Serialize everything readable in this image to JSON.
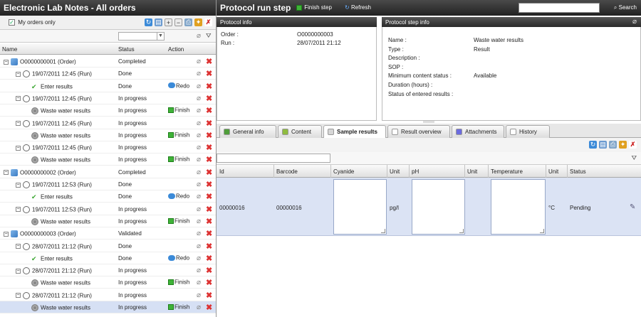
{
  "left": {
    "title": "Electronic Lab Notes - All orders",
    "my_orders_label": "My orders only",
    "columns": {
      "name": "Name",
      "status": "Status",
      "action": "Action"
    },
    "rows": [
      {
        "name": "O0000000001 (Order)",
        "status": "Completed",
        "action": "",
        "icon": "order-icon",
        "level": 0,
        "exp": "⊟"
      },
      {
        "name": "19/07/2011 12:45 (Run)",
        "status": "Done",
        "action": "",
        "icon": "clock-icon",
        "level": 1,
        "exp": "⊟"
      },
      {
        "name": "Enter results",
        "status": "Done",
        "action": "Redo",
        "icon": "check-icon",
        "level": 2,
        "exp": ""
      },
      {
        "name": "19/07/2011 12:45 (Run)",
        "status": "In progress",
        "action": "",
        "icon": "clock-icon",
        "level": 1,
        "exp": "⊟"
      },
      {
        "name": "Waste water results",
        "status": "In progress",
        "action": "Finish",
        "icon": "gear-icon",
        "level": 2,
        "exp": ""
      },
      {
        "name": "19/07/2011 12:45 (Run)",
        "status": "In progress",
        "action": "",
        "icon": "clock-icon",
        "level": 1,
        "exp": "⊟"
      },
      {
        "name": "Waste water results",
        "status": "In progress",
        "action": "Finish",
        "icon": "gear-icon",
        "level": 2,
        "exp": ""
      },
      {
        "name": "19/07/2011 12:45 (Run)",
        "status": "In progress",
        "action": "",
        "icon": "clock-icon",
        "level": 1,
        "exp": "⊟"
      },
      {
        "name": "Waste water results",
        "status": "In progress",
        "action": "Finish",
        "icon": "gear-icon",
        "level": 2,
        "exp": ""
      },
      {
        "name": "O0000000002 (Order)",
        "status": "Completed",
        "action": "",
        "icon": "order-icon",
        "level": 0,
        "exp": "⊟"
      },
      {
        "name": "19/07/2011 12:53 (Run)",
        "status": "Done",
        "action": "",
        "icon": "clock-icon",
        "level": 1,
        "exp": "⊟"
      },
      {
        "name": "Enter results",
        "status": "Done",
        "action": "Redo",
        "icon": "check-icon",
        "level": 2,
        "exp": ""
      },
      {
        "name": "19/07/2011 12:53 (Run)",
        "status": "In progress",
        "action": "",
        "icon": "clock-icon",
        "level": 1,
        "exp": "⊟"
      },
      {
        "name": "Waste water results",
        "status": "In progress",
        "action": "Finish",
        "icon": "gear-icon",
        "level": 2,
        "exp": ""
      },
      {
        "name": "O0000000003 (Order)",
        "status": "Validated",
        "action": "",
        "icon": "order-icon",
        "level": 0,
        "exp": "⊟"
      },
      {
        "name": "28/07/2011 21:12 (Run)",
        "status": "Done",
        "action": "",
        "icon": "clock-icon",
        "level": 1,
        "exp": "⊟"
      },
      {
        "name": "Enter results",
        "status": "Done",
        "action": "Redo",
        "icon": "check-icon",
        "level": 2,
        "exp": ""
      },
      {
        "name": "28/07/2011 21:12 (Run)",
        "status": "In progress",
        "action": "",
        "icon": "clock-icon",
        "level": 1,
        "exp": "⊟"
      },
      {
        "name": "Waste water results",
        "status": "In progress",
        "action": "Finish",
        "icon": "gear-icon",
        "level": 2,
        "exp": ""
      },
      {
        "name": "28/07/2011 21:12 (Run)",
        "status": "In progress",
        "action": "",
        "icon": "clock-icon",
        "level": 1,
        "exp": "⊟"
      },
      {
        "name": "Waste water results",
        "status": "In progress",
        "action": "Finish",
        "icon": "gear-icon",
        "level": 2,
        "exp": "",
        "selected": true
      }
    ]
  },
  "right": {
    "title": "Protocol run step",
    "finish_step_label": "Finish step",
    "refresh_label": "Refresh",
    "search_label": "Search",
    "protocol_info": {
      "header": "Protocol info",
      "order_label": "Order :",
      "order_value": "O0000000003",
      "run_label": "Run :",
      "run_value": "28/07/2011 21:12"
    },
    "step_info": {
      "header": "Protocol step info",
      "fields": [
        {
          "label": "Name :",
          "value": "Waste water results"
        },
        {
          "label": "Type :",
          "value": "Result"
        },
        {
          "label": "Description :",
          "value": ""
        },
        {
          "label": "SOP :",
          "value": ""
        },
        {
          "label": "Minimum content status :",
          "value": "Available"
        },
        {
          "label": "Duration (hours) :",
          "value": ""
        },
        {
          "label": "Status of entered results :",
          "value": ""
        }
      ]
    },
    "tabs": [
      {
        "label": "General info",
        "icon": "pencil-icon"
      },
      {
        "label": "Content",
        "icon": "edit-icon"
      },
      {
        "label": "Sample results",
        "icon": "flask-icon",
        "active": true
      },
      {
        "label": "Result overview",
        "icon": "document-icon"
      },
      {
        "label": "Attachments",
        "icon": "paperclip-icon"
      },
      {
        "label": "History",
        "icon": "history-icon"
      }
    ],
    "grid": {
      "columns": [
        "Id",
        "Barcode",
        "Cyanide",
        "Unit",
        "pH",
        "Unit",
        "Temperature",
        "Unit",
        "Status"
      ],
      "row": {
        "id": "00000016",
        "barcode": "00000016",
        "cyanide_unit": "pg/l",
        "temperature_unit": "°C",
        "status": "Pending"
      }
    }
  },
  "colors": {
    "title_bg": "#2a2a2a",
    "finish_green": "#3fb338",
    "delete_red": "#d33333",
    "selected_row": "#d6e0f4"
  }
}
